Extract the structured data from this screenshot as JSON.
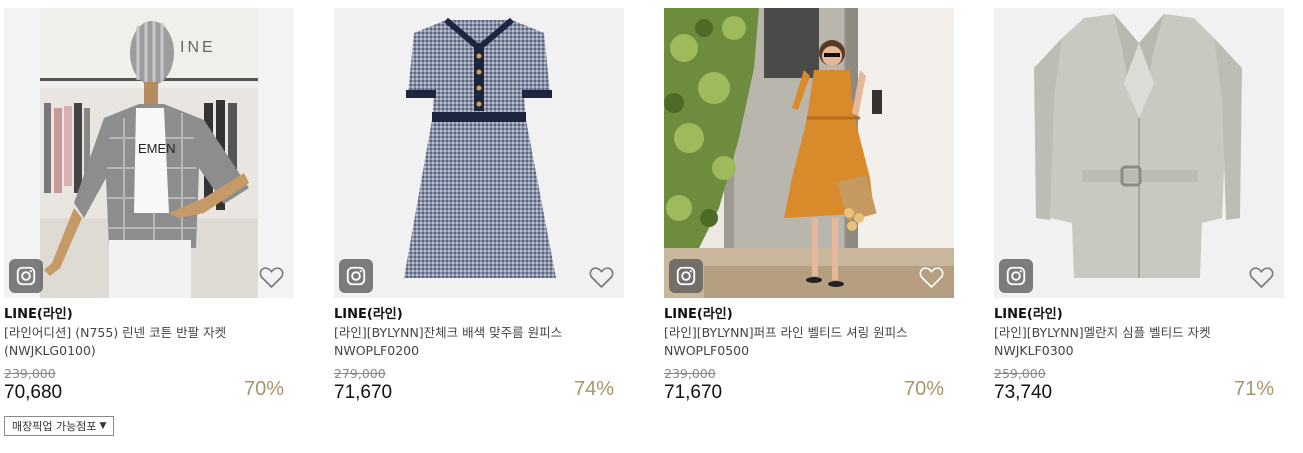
{
  "products": [
    {
      "brand": "LINE(라인)",
      "name": "[라인어디션] (N755) 린넨 코튼 반팔 자켓",
      "code": "(NWJKLG0100)",
      "original_price": "239,000",
      "sale_price": "70,680",
      "discount_rate": "70%",
      "image": "checked-jacket-mannequin-in-store"
    },
    {
      "brand": "LINE(라인)",
      "name": "[라인][BYLYNN]잔체크 배색 맞주름 원피스",
      "code": "NWOPLF0200",
      "original_price": "279,000",
      "sale_price": "71,670",
      "discount_rate": "74%",
      "image": "navy-gingham-dress"
    },
    {
      "brand": "LINE(라인)",
      "name": "[라인][BYLYNN]퍼프 라인 벨티드 셔링 원피스",
      "code": "NWOPLF0500",
      "original_price": "239,000",
      "sale_price": "71,670",
      "discount_rate": "70%",
      "image": "model-in-orange-dress-at-door"
    },
    {
      "brand": "LINE(라인)",
      "name": "[라인][BYLYNN]멜란지 심플 벨티드 자켓",
      "code": "NWJKLF0300",
      "original_price": "259,000",
      "sale_price": "73,740",
      "discount_rate": "71%",
      "image": "grey-belted-jacket"
    }
  ],
  "pickup_filter": {
    "label": "매장픽업 가능점포"
  },
  "icons": {
    "instagram": "instagram-icon",
    "wishlist": "heart-icon",
    "dropdown": "caret-down-icon"
  },
  "colors": {
    "discount": "#a8946a",
    "text": "#222222",
    "original_price": "#888888"
  }
}
